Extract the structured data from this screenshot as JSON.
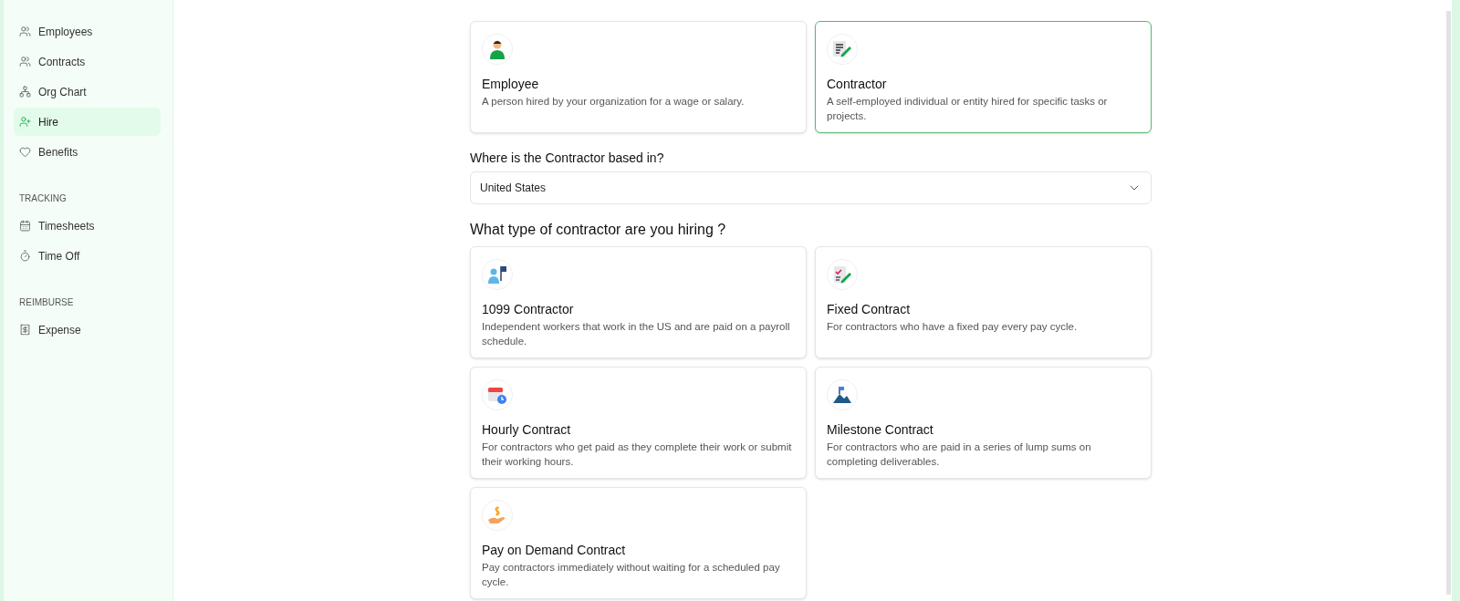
{
  "sidebar": {
    "groups": [
      {
        "items": [
          {
            "label": "Employees",
            "selected": false
          },
          {
            "label": "Contracts",
            "selected": false
          },
          {
            "label": "Org Chart",
            "selected": false
          },
          {
            "label": "Hire",
            "selected": true
          },
          {
            "label": "Benefits",
            "selected": false
          }
        ]
      },
      {
        "heading": "TRACKING",
        "items": [
          {
            "label": "Timesheets",
            "selected": false
          },
          {
            "label": "Time Off",
            "selected": false
          }
        ]
      },
      {
        "heading": "REIMBURSE",
        "items": [
          {
            "label": "Expense",
            "selected": false
          }
        ]
      }
    ]
  },
  "worker_types": [
    {
      "title": "Employee",
      "description": "A person hired by your organization for a wage or salary.",
      "selected": false
    },
    {
      "title": "Contractor",
      "description": "A self-employed individual or entity hired for specific tasks or projects.",
      "selected": true
    }
  ],
  "location": {
    "label": "Where is the Contractor based in?",
    "value": "United States"
  },
  "contract_heading": "What type of contractor are you hiring ?",
  "contract_types": [
    {
      "title": "1099 Contractor",
      "description": "Independent workers that work in the US and are paid on a payroll schedule."
    },
    {
      "title": "Fixed Contract",
      "description": "For contractors who have a fixed pay every pay cycle."
    },
    {
      "title": "Hourly Contract",
      "description": "For contractors who get paid as they complete their work or submit their working hours."
    },
    {
      "title": "Milestone Contract",
      "description": "For contractors who are paid in a series of lump sums on completing deliverables."
    },
    {
      "title": "Pay on Demand Contract",
      "description": "Pay contractors immediately without waiting for a scheduled pay cycle."
    }
  ]
}
